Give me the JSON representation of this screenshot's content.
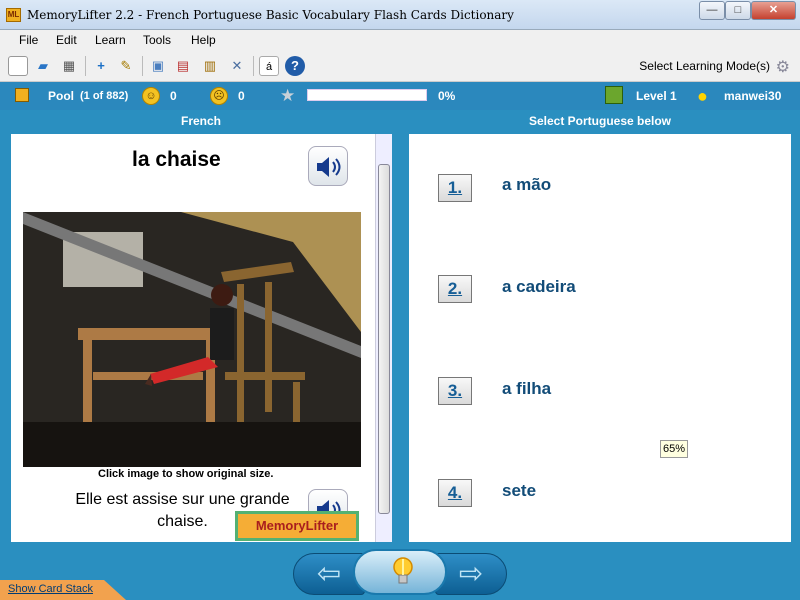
{
  "window": {
    "title": "MemoryLifter 2.2 - French Portuguese Basic Vocabulary Flash Cards Dictionary",
    "min": "—",
    "max": "□",
    "close": "✕",
    "app_icon_text": "ML"
  },
  "menu": [
    "File",
    "Edit",
    "Learn",
    "Tools",
    "Help"
  ],
  "toolbar": {
    "learning_mode_label": "Select Learning Mode(s)",
    "icons": [
      "new-document-icon",
      "open-folder-icon",
      "print-icon",
      "add-card-icon",
      "edit-icon",
      "presentation-icon",
      "media-icon",
      "card-stack-icon",
      "tools-icon",
      "font-icon",
      "help-icon"
    ]
  },
  "status": {
    "pool_label": "Pool",
    "pool_count": "(1 of 882)",
    "right_count": "0",
    "wrong_count": "0",
    "progress_percent": 0,
    "progress_label": "0%",
    "level": "Level 1",
    "user": "manwei30"
  },
  "question": {
    "header": "French",
    "word": "la chaise",
    "image_caption": "Click image to show original size.",
    "example_sentence": "Elle est assise sur une grande chaise.",
    "brand_text": "MemoryLifter"
  },
  "answers": {
    "header": "Select Portuguese below",
    "choices": [
      {
        "number": "1.",
        "text": "a mão"
      },
      {
        "number": "2.",
        "text": "a cadeira"
      },
      {
        "number": "3.",
        "text": "a filha"
      },
      {
        "number": "4.",
        "text": "sete"
      }
    ],
    "badge": "65%"
  },
  "footer": {
    "show_card_stack": "Show Card Stack",
    "back_arrow": "⇦",
    "next_arrow": "⇨"
  },
  "colors": {
    "accent": "#2b88bd",
    "choice_text": "#124c78",
    "close_button": "#c4412f",
    "brand_orange": "#f5ad36"
  }
}
